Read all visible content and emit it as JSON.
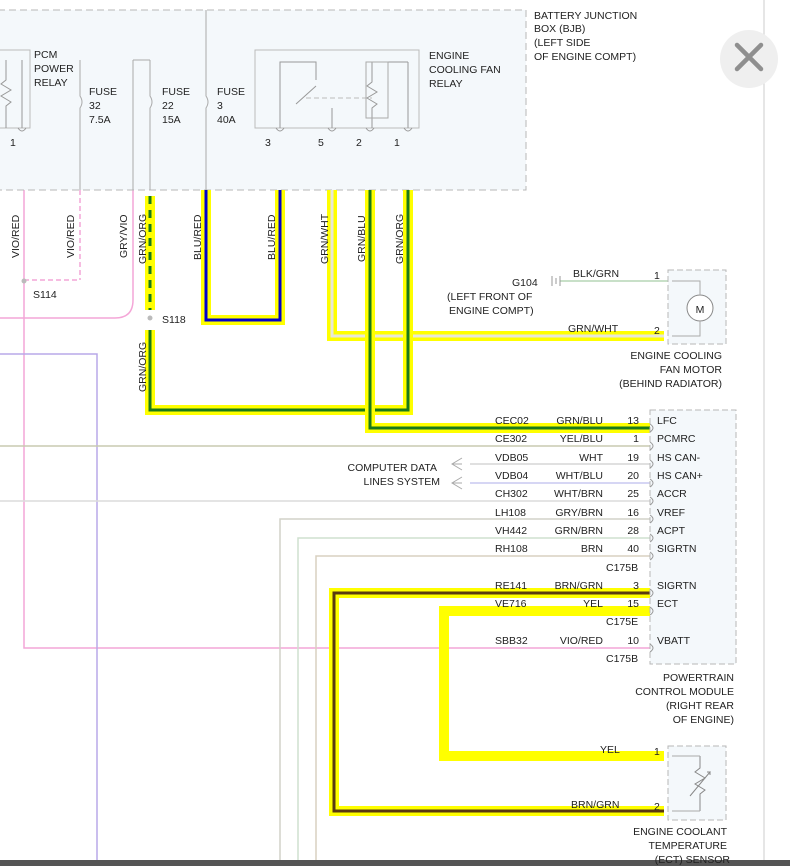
{
  "bjb": {
    "title": [
      "BATTERY JUNCTION",
      "BOX (BJB)",
      "(LEFT SIDE",
      "OF ENGINE COMPT)"
    ],
    "pcm_relay": [
      "PCM",
      "POWER",
      "RELAY"
    ],
    "fuse32": [
      "FUSE",
      "32",
      "7.5A"
    ],
    "fuse22": [
      "FUSE",
      "22",
      "15A"
    ],
    "fuse3": [
      "FUSE",
      "3",
      "40A"
    ],
    "fan_relay": [
      "ENGINE",
      "COOLING FAN",
      "RELAY"
    ],
    "pins": [
      "1",
      "3",
      "5",
      "2",
      "1"
    ]
  },
  "vertical_wire_labels": [
    "VIO/RED",
    "VIO/RED",
    "GRY/VIO",
    "GRN/ORG",
    "BLU/RED",
    "BLU/RED",
    "GRN/WHT",
    "GRN/BLU",
    "GRN/ORG",
    "GRN/ORG"
  ],
  "splices": [
    "S114",
    "S118"
  ],
  "ground": {
    "id": "G104",
    "location": [
      "(LEFT FRONT OF",
      "ENGINE COMPT)"
    ],
    "wire": "BLK/GRN",
    "pin": "1"
  },
  "fan_motor": {
    "wire": "GRN/WHT",
    "pin": "2",
    "symbol": "M",
    "name": [
      "ENGINE COOLING",
      "FAN MOTOR",
      "(BEHIND RADIATOR)"
    ]
  },
  "computer_data": [
    "COMPUTER DATA",
    "LINES SYSTEM"
  ],
  "pcm_rows": [
    {
      "circuit": "CEC02",
      "color": "GRN/BLU",
      "pin": "13",
      "signal": "LFC"
    },
    {
      "circuit": "CE302",
      "color": "YEL/BLU",
      "pin": "1",
      "signal": "PCMRC"
    },
    {
      "circuit": "VDB05",
      "color": "WHT",
      "pin": "19",
      "signal": "HS CAN-"
    },
    {
      "circuit": "VDB04",
      "color": "WHT/BLU",
      "pin": "20",
      "signal": "HS CAN+"
    },
    {
      "circuit": "CH302",
      "color": "WHT/BRN",
      "pin": "25",
      "signal": "ACCR"
    },
    {
      "circuit": "LH108",
      "color": "GRY/BRN",
      "pin": "16",
      "signal": "VREF"
    },
    {
      "circuit": "VH442",
      "color": "GRN/BRN",
      "pin": "28",
      "signal": "ACPT"
    },
    {
      "circuit": "RH108",
      "color": "BRN",
      "pin": "40",
      "signal": "SIGRTN"
    },
    {
      "circuit": "RE141",
      "color": "BRN/GRN",
      "pin": "3",
      "signal": "SIGRTN"
    },
    {
      "circuit": "VE716",
      "color": "YEL",
      "pin": "15",
      "signal": "ECT"
    },
    {
      "circuit": "SBB32",
      "color": "VIO/RED",
      "pin": "10",
      "signal": "VBATT"
    }
  ],
  "connectors": [
    "C175B",
    "C175E",
    "C175B"
  ],
  "pcm_name": [
    "POWERTRAIN",
    "CONTROL MODULE",
    "(RIGHT REAR",
    "OF ENGINE)"
  ],
  "ect": {
    "wires": [
      {
        "color": "YEL",
        "pin": "1"
      },
      {
        "color": "BRN/GRN",
        "pin": "2"
      }
    ],
    "name": [
      "ENGINE COOLANT",
      "TEMPERATURE",
      "(ECT) SENSOR"
    ]
  },
  "colors": {
    "highlight": "#ffff00",
    "blue": "#0000cc",
    "green": "#1a7a1a",
    "brown": "#5a3a10",
    "pink": "#f4a6d7",
    "lavender": "#b8a8e8",
    "box_fill": "#f4f8fb",
    "box_border": "#b7b7b7"
  },
  "close_icon": "close-icon"
}
